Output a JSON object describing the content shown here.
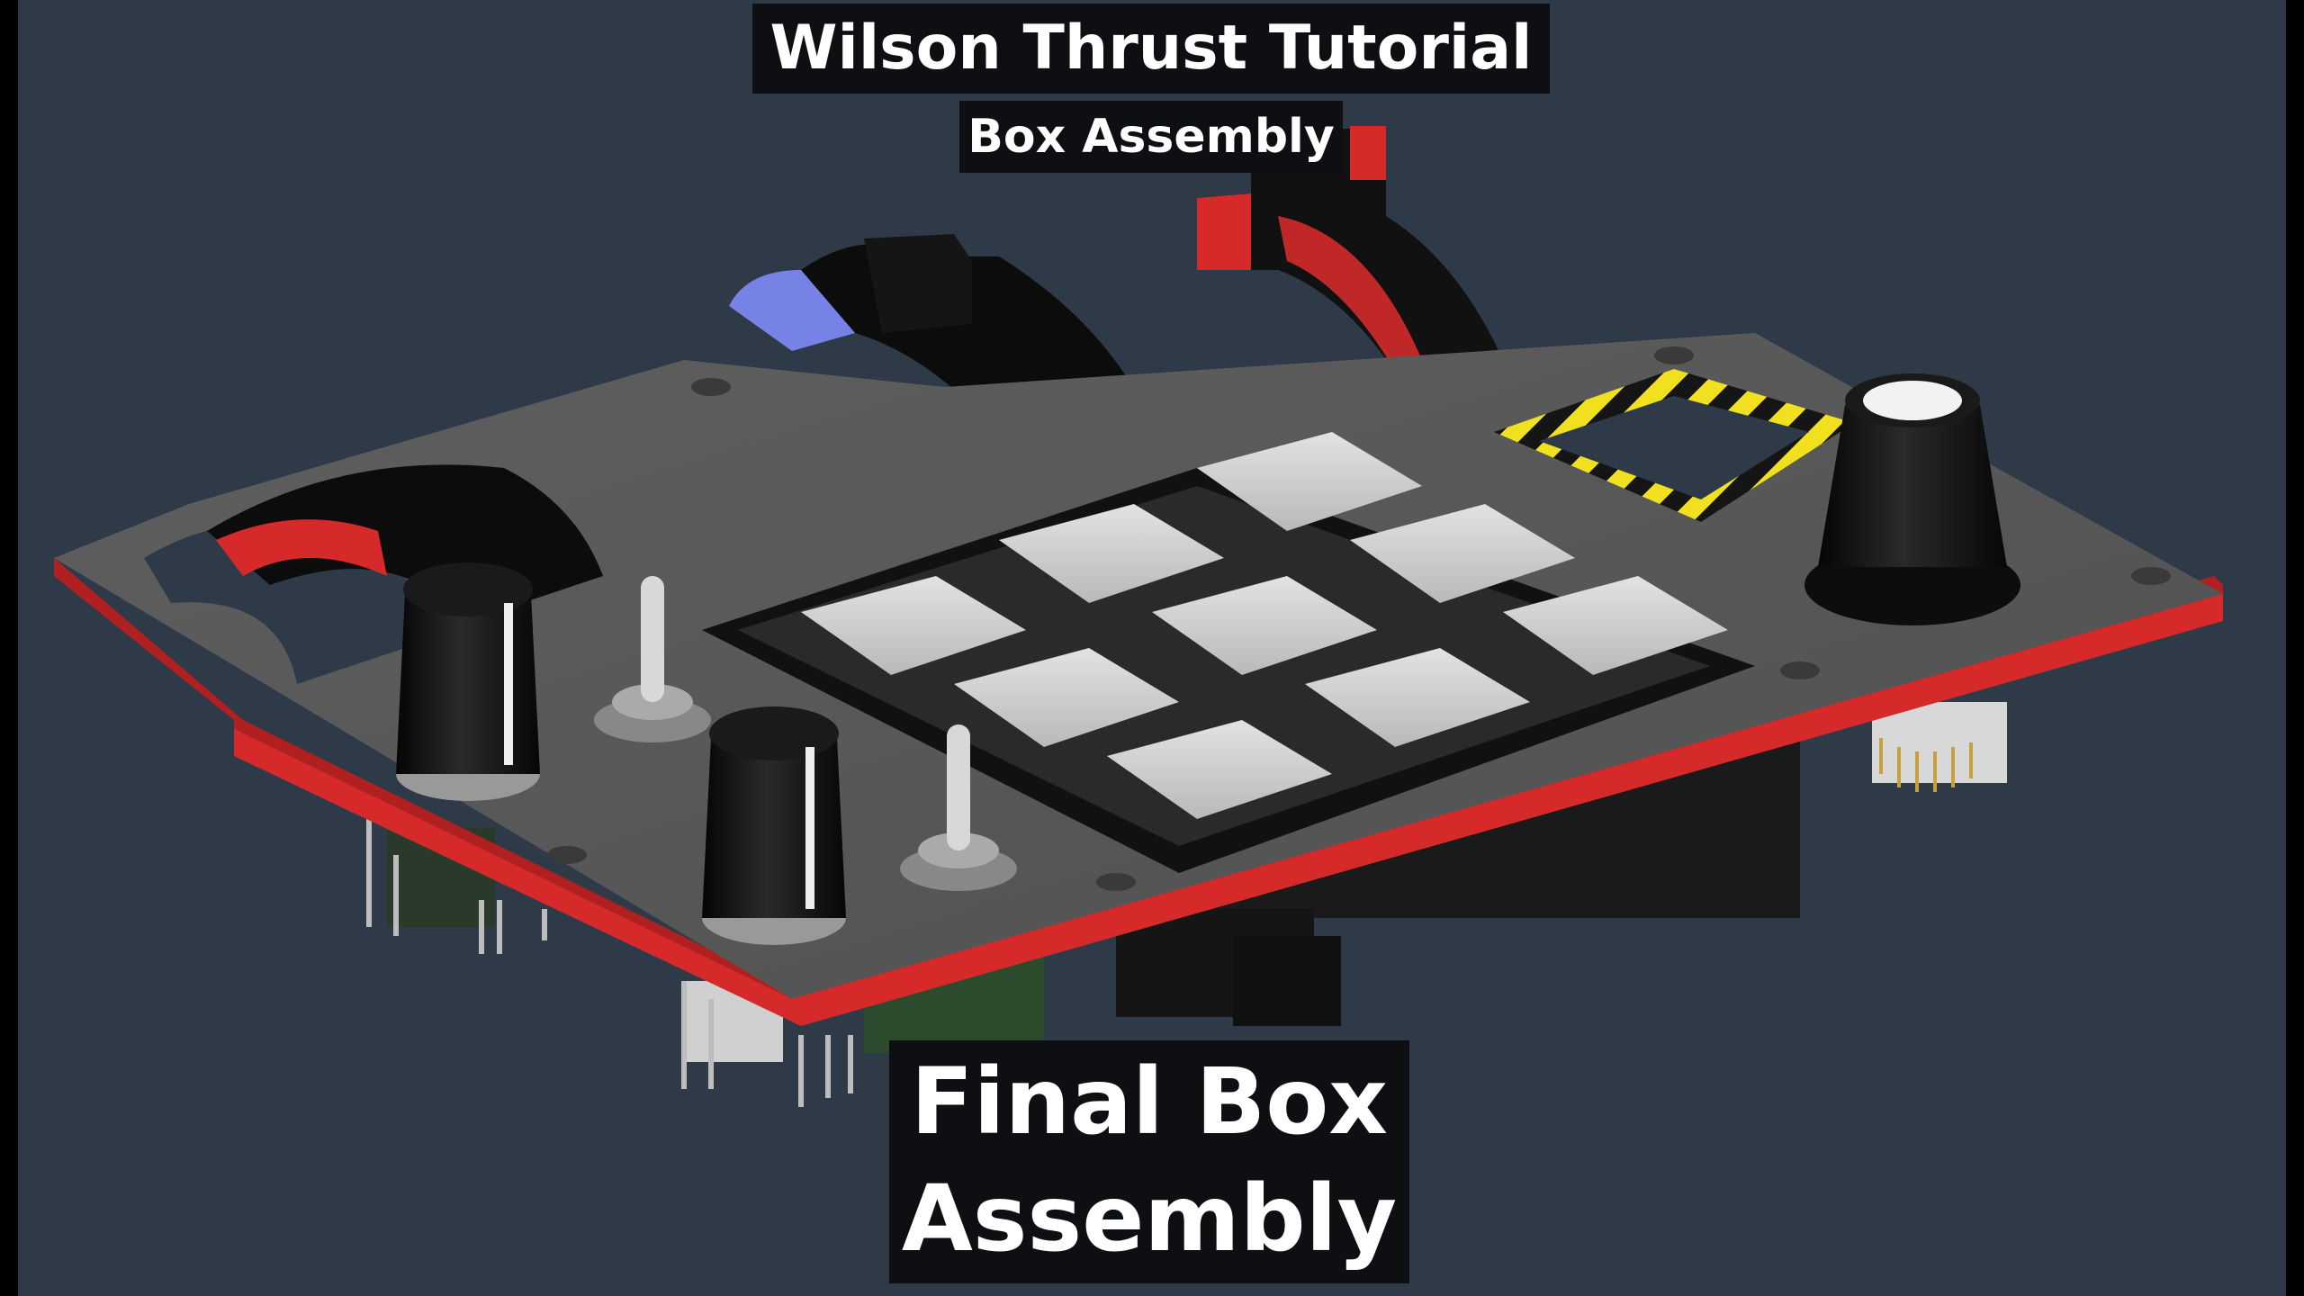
{
  "title": "Wilson Thrust Tutorial",
  "subtitle": "Box Assembly",
  "caption": {
    "line1": "Final Box",
    "line2": "Assembly"
  },
  "colors": {
    "background": "#2f3a48",
    "panel_top": "#5a5a5a",
    "panel_edge": "#d62a2a",
    "keycap": "#cfcfcf",
    "knob": "#111111",
    "hazard_yellow": "#f0e020",
    "blue_accent": "#7782e6"
  }
}
